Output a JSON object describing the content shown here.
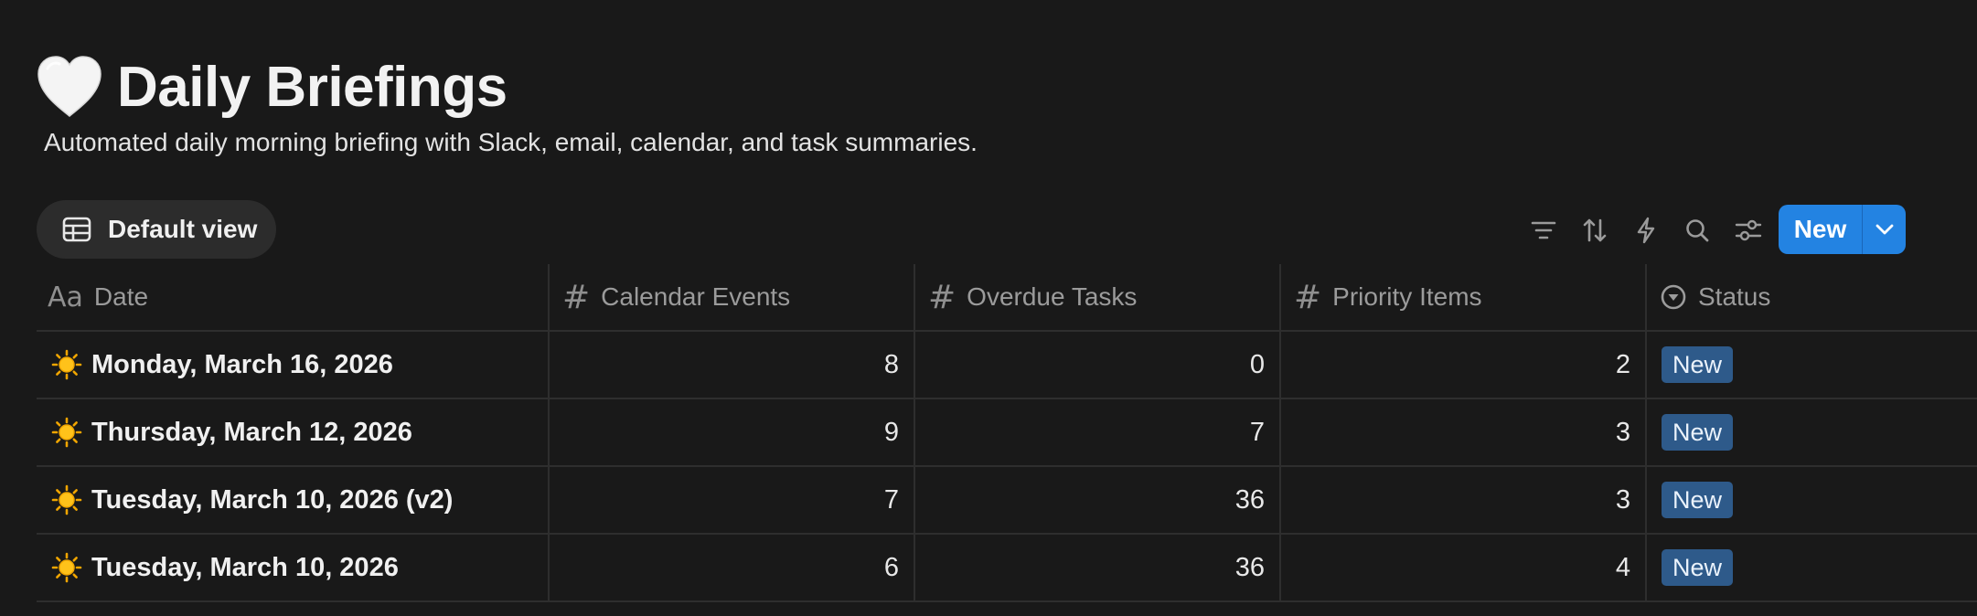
{
  "page": {
    "icon": "white-heart-icon",
    "title": "Daily Briefings",
    "subtitle": "Automated daily morning briefing with Slack, email, calendar, and task summaries."
  },
  "view": {
    "icon": "table-icon",
    "label": "Default view"
  },
  "toolbar": {
    "icons": [
      "filter-icon",
      "sort-icon",
      "lightning-icon",
      "search-icon",
      "settings-sliders-icon"
    ],
    "new_label": "New",
    "new_color": "#2383e2"
  },
  "table": {
    "columns": [
      {
        "icon": "text-type-icon",
        "icon_text": "Aa",
        "label": "Date"
      },
      {
        "icon": "hash-icon",
        "icon_text": "#",
        "label": "Calendar Events"
      },
      {
        "icon": "hash-icon",
        "icon_text": "#",
        "label": "Overdue Tasks"
      },
      {
        "icon": "hash-icon",
        "icon_text": "#",
        "label": "Priority Items"
      },
      {
        "icon": "status-circle-icon",
        "label": "Status"
      }
    ],
    "rows": [
      {
        "icon": "sun-icon",
        "date": "Monday, March 16, 2026",
        "calendar_events": "8",
        "overdue_tasks": "0",
        "priority_items": "2",
        "status": "New"
      },
      {
        "icon": "sun-icon",
        "date": "Thursday, March 12, 2026",
        "calendar_events": "9",
        "overdue_tasks": "7",
        "priority_items": "3",
        "status": "New"
      },
      {
        "icon": "sun-icon",
        "date": "Tuesday, March 10, 2026 (v2)",
        "calendar_events": "7",
        "overdue_tasks": "36",
        "priority_items": "3",
        "status": "New"
      },
      {
        "icon": "sun-icon",
        "date": "Tuesday, March 10, 2026",
        "calendar_events": "6",
        "overdue_tasks": "36",
        "priority_items": "4",
        "status": "New"
      }
    ],
    "status_badge_color": "#2e5a8a"
  }
}
